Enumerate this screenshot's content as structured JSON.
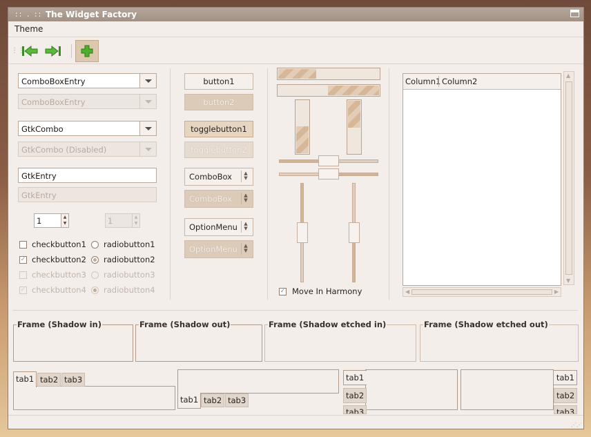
{
  "window": {
    "title": "The Widget Factory"
  },
  "menubar": {
    "theme": "Theme"
  },
  "toolbar": {
    "back": "back-arrow",
    "forward": "forward-arrow",
    "add": "add"
  },
  "col1": {
    "combo_entry": "ComboBoxEntry",
    "combo_entry_dis": "ComboBoxEntry",
    "gtk_combo": "GtkCombo",
    "gtk_combo_dis": "GtkCombo (Disabled)",
    "gtk_entry": "GtkEntry",
    "gtk_entry_dis": "GtkEntry",
    "spin_value": "1",
    "spin_value_dis": "1",
    "checks": [
      "checkbutton1",
      "checkbutton2",
      "checkbutton3",
      "checkbutton4"
    ],
    "radios": [
      "radiobutton1",
      "radiobutton2",
      "radiobutton3",
      "radiobutton4"
    ]
  },
  "col2": {
    "button1": "button1",
    "button2": "button2",
    "toggle1": "togglebutton1",
    "toggle2": "togglebutton2",
    "combobox": "ComboBox",
    "combobox_dis": "ComboBox",
    "optionmenu": "OptionMenu",
    "optionmenu_dis": "OptionMenu"
  },
  "col3": {
    "move_in_harmony": "Move In Harmony",
    "progress_h1": 0.37,
    "progress_h2": 0.5,
    "progress_v1": 0.5,
    "progress_v2": 0.5,
    "scale_h1": 0.5,
    "scale_h2": 0.5,
    "scale_v1": 0.5,
    "scale_v2": 0.5
  },
  "tree": {
    "columns": [
      "Column1",
      "Column2"
    ]
  },
  "frames": [
    "Frame (Shadow in)",
    "Frame (Shadow out)",
    "Frame (Shadow etched in)",
    "Frame (Shadow etched out)"
  ],
  "notebooks": {
    "tabs": [
      "tab1",
      "tab2",
      "tab3"
    ]
  }
}
